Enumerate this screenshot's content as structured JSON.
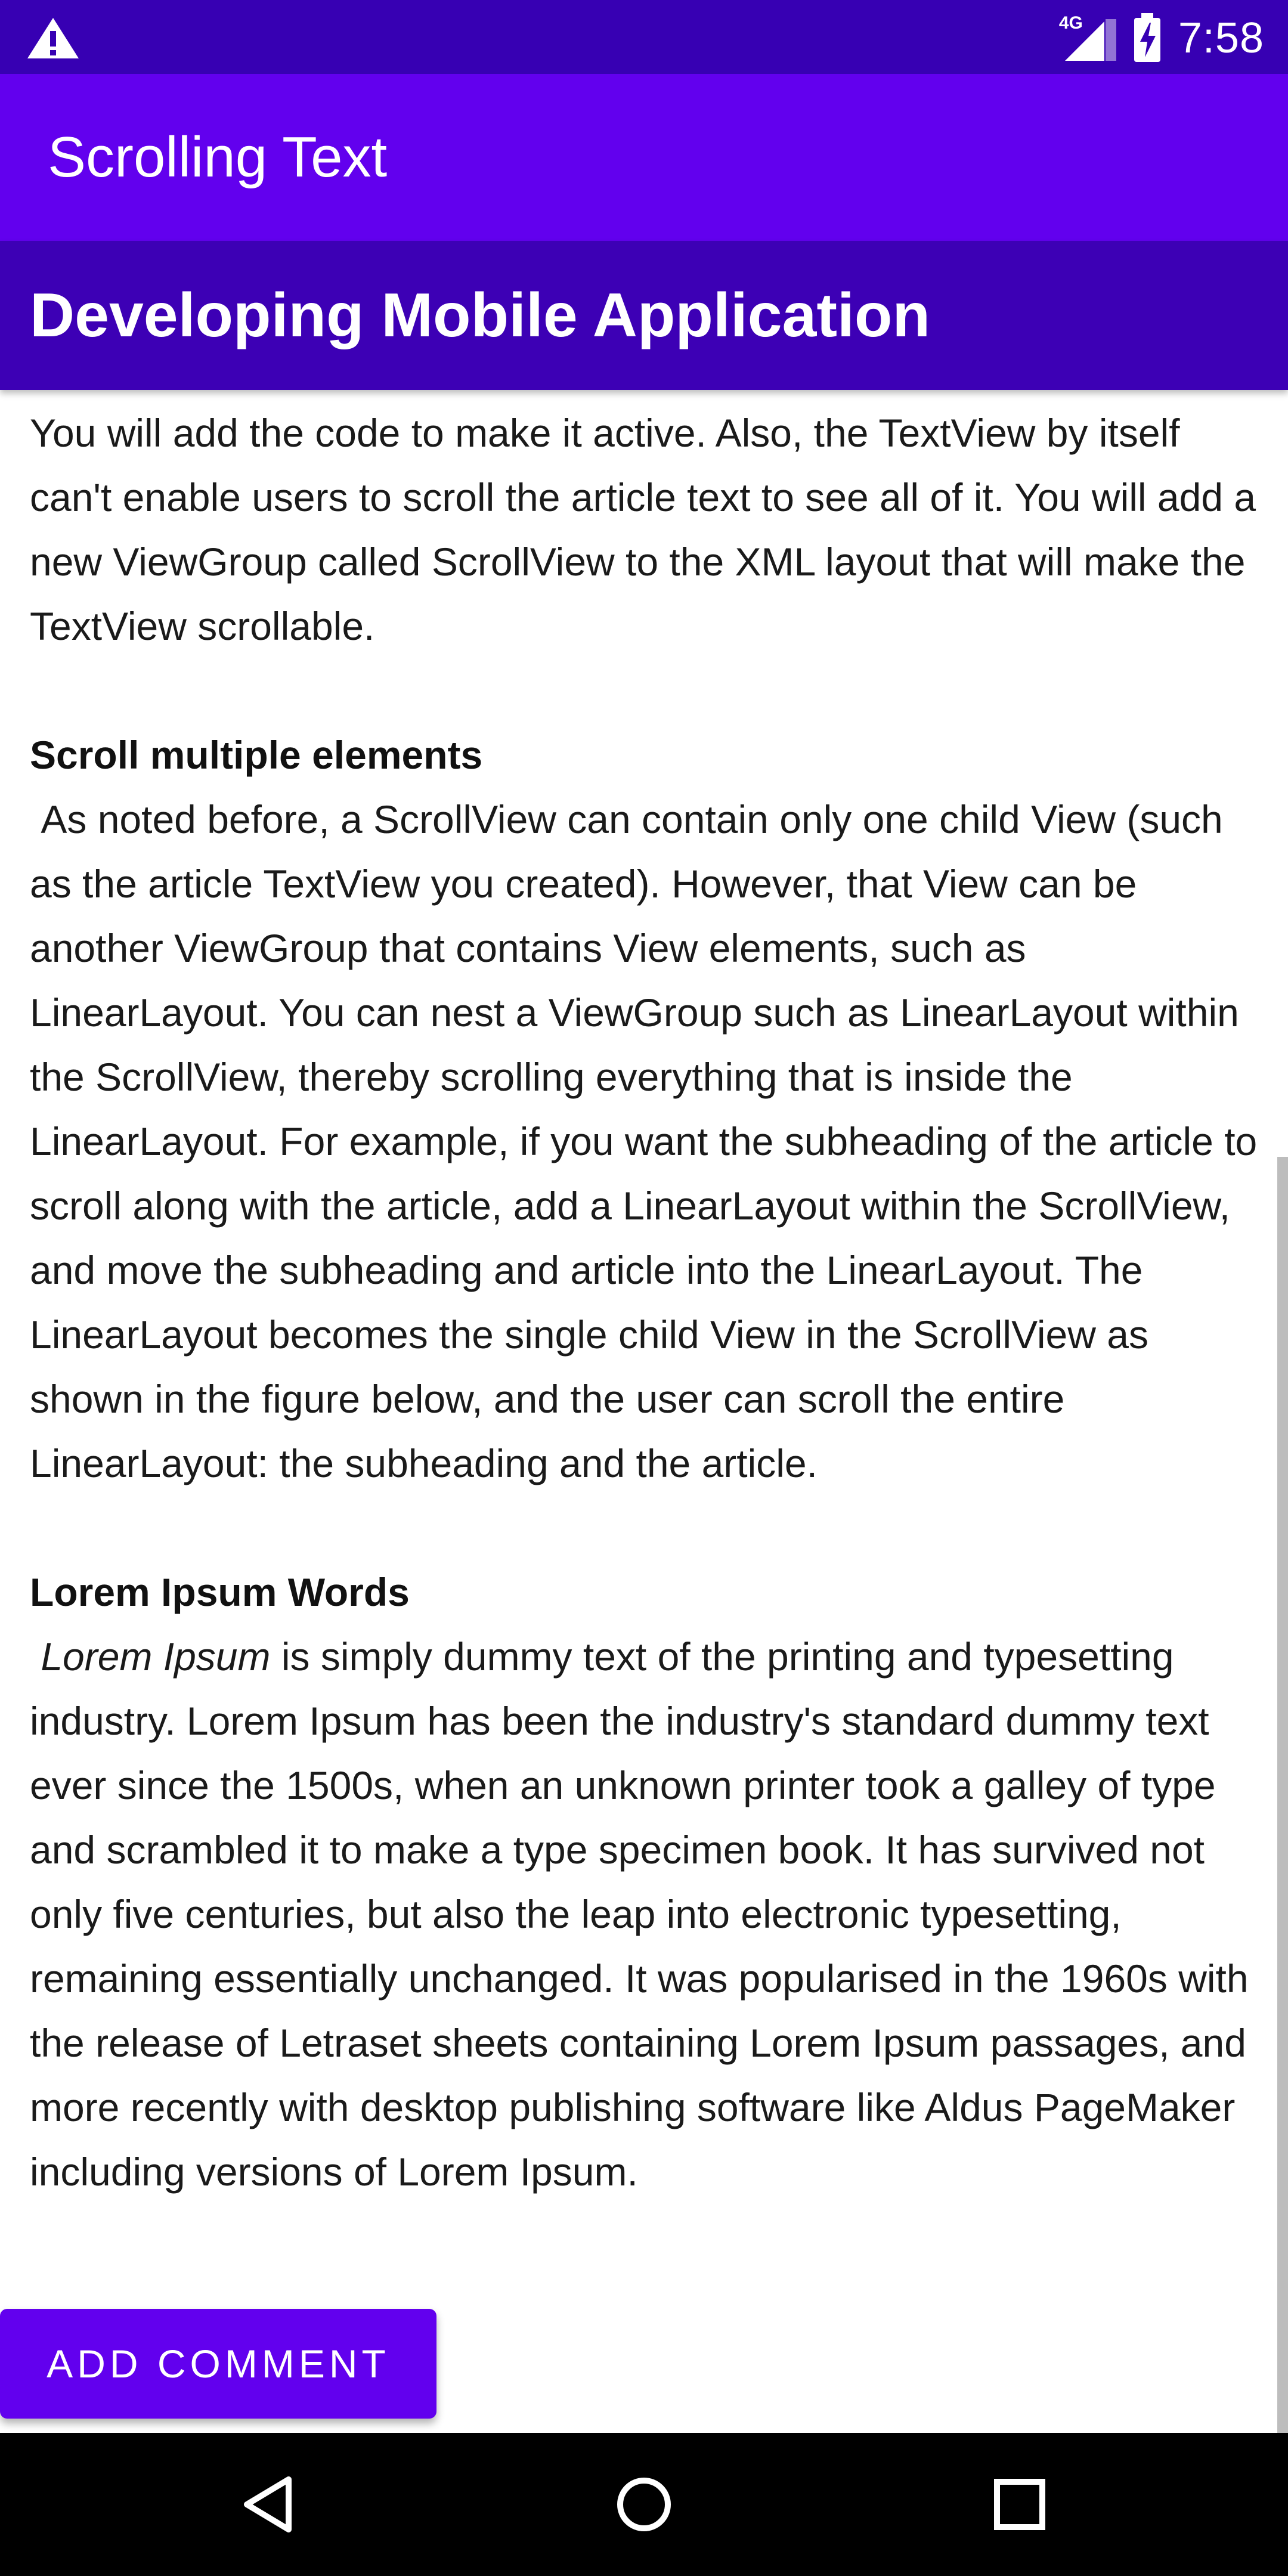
{
  "status_bar": {
    "time": "7:58",
    "network": "4G",
    "icons": [
      "warning-icon",
      "signal-icon",
      "battery-charging-icon"
    ]
  },
  "app_bar": {
    "title": "Scrolling Text"
  },
  "heading": "Developing Mobile Application",
  "article": {
    "intro": "You will add the code to make it active. Also, the TextView by itself can't enable users to scroll the article text to see all of it. You will add a new ViewGroup called ScrollView to the XML layout that will make the TextView scrollable.",
    "section1_title": "Scroll multiple elements",
    "section1_body": "As noted before, a ScrollView can contain only one child View (such as the article TextView you created). However, that View can be another ViewGroup that contains View elements, such as LinearLayout. You can nest a ViewGroup such as LinearLayout within the ScrollView, thereby scrolling everything that is inside the LinearLayout. For example, if you want the subheading of the article to scroll along with the article, add a LinearLayout within the ScrollView, and move the subheading and article into the LinearLayout. The LinearLayout becomes the single child View in the ScrollView as shown in the figure below, and the user can scroll the entire LinearLayout: the subheading and the article.",
    "section2_title": "Lorem Ipsum Words",
    "section2_italic": "Lorem Ipsum",
    "section2_body": " is simply dummy text of the printing and typesetting industry. Lorem Ipsum has been the industry's standard dummy text ever since the 1500s, when an unknown printer took a galley of type and scrambled it to make a type specimen book. It has survived not only five centuries, but also the leap into electronic typesetting, remaining essentially unchanged. It was popularised in the 1960s with the release of Letraset sheets containing Lorem Ipsum passages, and more recently with desktop publishing software like Aldus PageMaker including versions of Lorem Ipsum."
  },
  "button": {
    "label": "ADD COMMENT"
  },
  "nav_bar": {
    "icons": [
      "back-icon",
      "home-icon",
      "recents-icon"
    ]
  },
  "colors": {
    "status_bar": "#3700b3",
    "app_bar": "#6200ee",
    "heading_band": "#3d00b5",
    "button": "#6200ee",
    "nav_bar": "#000000"
  }
}
